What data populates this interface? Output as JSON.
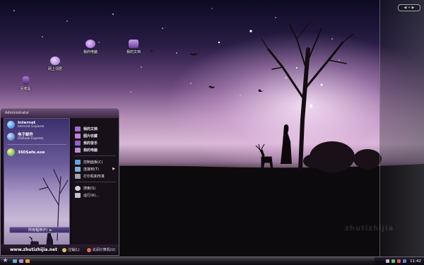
{
  "desktop": {
    "icons": [
      {
        "label": "我的电脑",
        "icon": "computer-icon",
        "color": "#b68cd8"
      },
      {
        "label": "我的文档",
        "icon": "documents-folder-icon",
        "color": "#9b6cc4"
      },
      {
        "label": "网上邻居",
        "icon": "network-icon",
        "color": "#c9a0e6"
      },
      {
        "label": "回收站",
        "icon": "recycle-bin-icon",
        "color": "#8a5aa8"
      }
    ],
    "watermark": "zhutizhijia"
  },
  "start_menu": {
    "user_name": "Administrator",
    "pinned": [
      {
        "name": "Internet",
        "sub": "Internet Explorer",
        "icon": "internet-explorer-icon",
        "color": "#3f8fe0"
      },
      {
        "name": "电子邮件",
        "sub": "Outlook Express",
        "icon": "outlook-express-icon",
        "color": "#4a7ed6"
      },
      {
        "name": "360Safe.exe",
        "sub": "",
        "icon": "360safe-icon",
        "color": "#e8d23a"
      }
    ],
    "all_programs": "所有程序(P)",
    "right_items": [
      {
        "label": "我的文档",
        "icon": "my-documents-icon",
        "color": "#a56bd0",
        "bold": true
      },
      {
        "label": "图片收藏",
        "icon": "my-pictures-icon",
        "color": "#c57fd9",
        "bold": true
      },
      {
        "label": "我的音乐",
        "icon": "my-music-icon",
        "color": "#8e62c9",
        "bold": true
      },
      {
        "label": "我的电脑",
        "icon": "my-computer-icon",
        "color": "#b68cd8",
        "bold": true
      },
      {
        "label": "控制面板(C)",
        "icon": "control-panel-icon",
        "color": "#6ba0e0",
        "bold": false
      },
      {
        "label": "连接到(T)",
        "icon": "connect-to-icon",
        "color": "#7fb0d8",
        "bold": false
      },
      {
        "label": "打印机和传真",
        "icon": "printers-icon",
        "color": "#a0a0b0",
        "bold": false
      },
      {
        "label": "搜索(S)",
        "icon": "search-icon",
        "color": "#d0d0e0",
        "bold": false
      },
      {
        "label": "运行(R)...",
        "icon": "run-icon",
        "color": "#c0c0d0",
        "bold": false
      }
    ],
    "footer": {
      "site": "www.zhutizhijia.net",
      "logoff": "注销(L)",
      "shutdown": "关闭计算机(U)"
    }
  },
  "taskbar": {
    "start_glyph": "★",
    "clock": "11:42"
  }
}
